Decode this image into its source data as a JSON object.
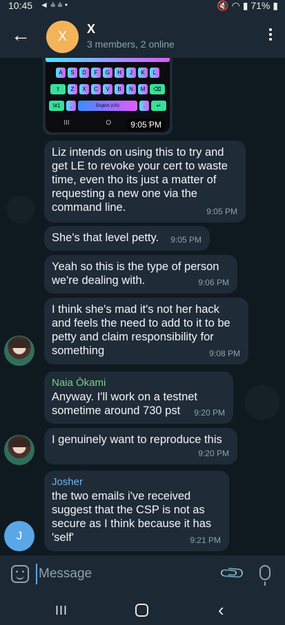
{
  "status_bar": {
    "time": "10:45",
    "left_icons": "◄ ⩮ ⩮ •",
    "battery": "71%"
  },
  "header": {
    "back_icon": "arrow-left",
    "avatar_letter": "X",
    "avatar_color": "#f3b35a",
    "title": "X",
    "subtitle": "3 members, 2 online"
  },
  "image_message": {
    "keyboard_rows": [
      [
        "A",
        "S",
        "D",
        "F",
        "G",
        "H",
        "J",
        "K",
        "L"
      ],
      [
        "Z",
        "X",
        "C",
        "V",
        "B",
        "N",
        "M"
      ]
    ],
    "space_label": "English (US)",
    "nav": [
      "III",
      "O",
      "<"
    ],
    "time": "9:05 PM"
  },
  "messages": [
    {
      "text": "Liz intends on using this to try and get LE to revoke your cert to waste time, even tho its just a matter of requesting a new one via the command line.",
      "time": "9:05 PM"
    },
    {
      "text": "She's that level petty.",
      "time": "9:05 PM"
    },
    {
      "text": "Yeah so this is the type of person we're dealing with.",
      "time": "9:06 PM"
    },
    {
      "text": "I think she's mad it's not her hack and feels the need to add to it to be petty and claim responsibility for something",
      "time": "9:08 PM"
    },
    {
      "sender": "Naia Ōkami",
      "sender_color": "#7fd08a",
      "text": "Anyway. I'll work on a testnet sometime around 730 pst",
      "time": "9:20 PM"
    },
    {
      "text": "I genuinely want to reproduce this",
      "time": "9:20 PM"
    },
    {
      "sender": "Josher",
      "sender_color": "#6fb3ee",
      "text": "the two emails i've received suggest that the CSP is not as secure as I think because it has 'self'",
      "time": "9:21 PM"
    }
  ],
  "josher_avatar_letter": "J",
  "composer": {
    "placeholder": "Message"
  },
  "colors": {
    "bubble": "#1f2b36",
    "background": "#0f1920",
    "bar": "#1c2833"
  }
}
